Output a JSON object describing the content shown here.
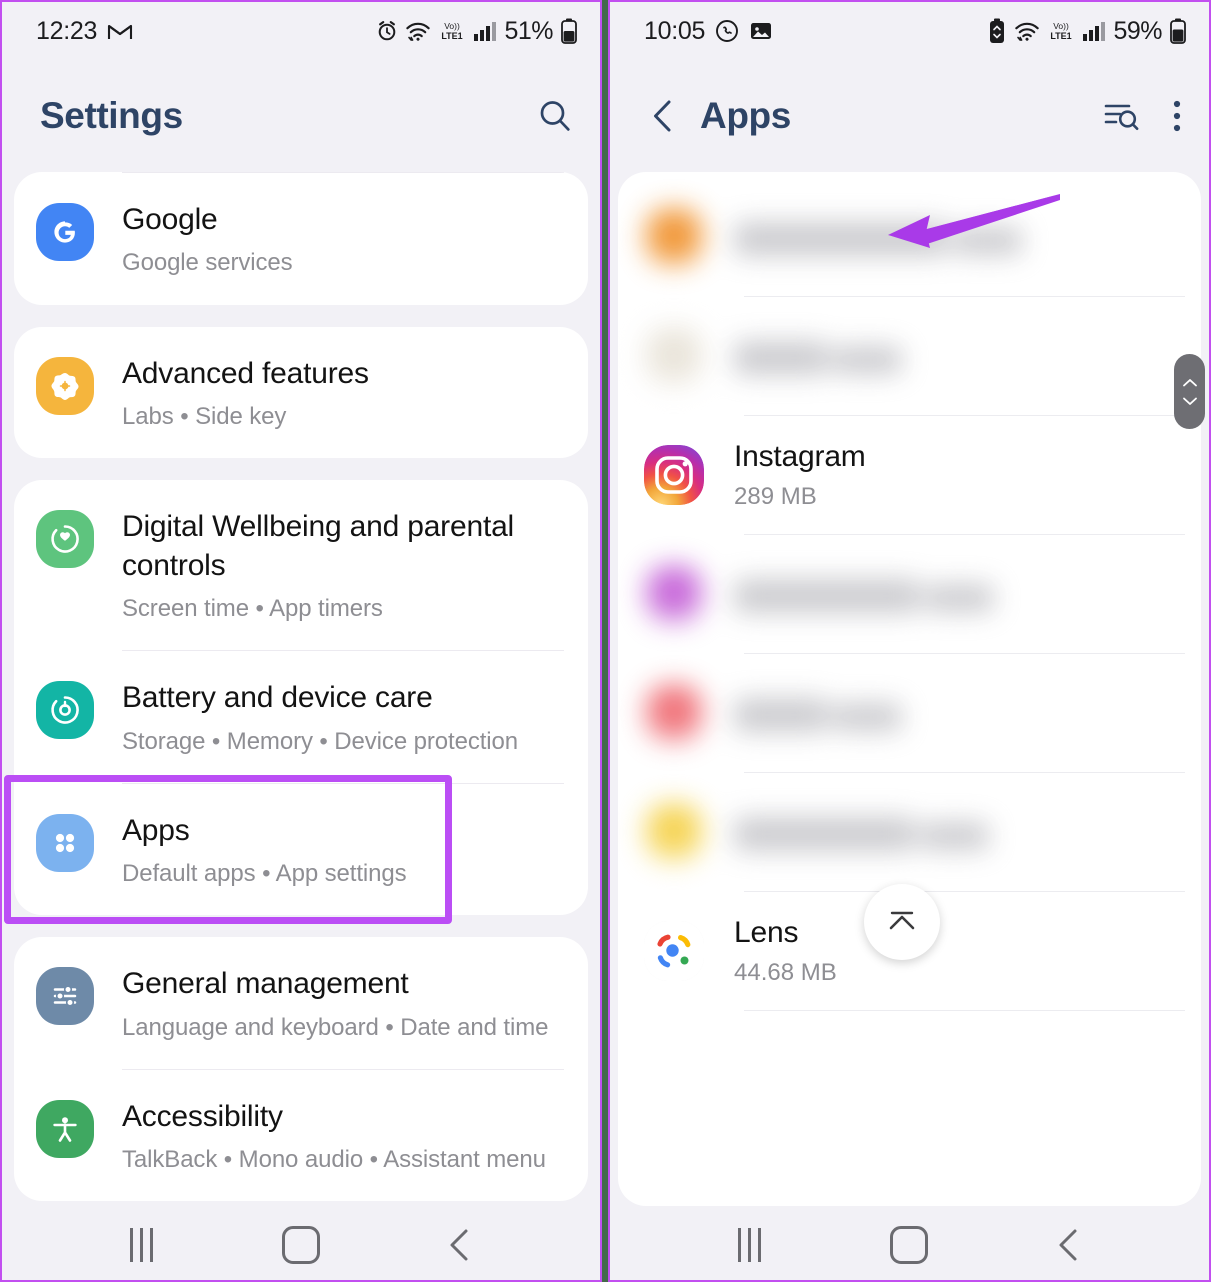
{
  "left_phone": {
    "status_bar": {
      "time": "12:23",
      "icons": [
        "gmail-icon",
        "alarm-icon",
        "wifi-icon",
        "volte-icon",
        "signal-icon"
      ],
      "battery_percent": "51%"
    },
    "header": {
      "title": "Settings",
      "search_icon": "search-icon"
    },
    "groups": [
      {
        "has_top_divider": true,
        "items": [
          {
            "title": "Google",
            "subtitle": "Google services",
            "icon": "google-icon",
            "icon_color": "#4285f4"
          }
        ]
      },
      {
        "has_top_divider": false,
        "items": [
          {
            "title": "Advanced features",
            "subtitle": "Labs • Side key",
            "icon": "advanced-features-icon",
            "icon_color": "#f5b53d"
          }
        ]
      },
      {
        "has_top_divider": false,
        "items": [
          {
            "title": "Digital Wellbeing and parental controls",
            "subtitle": "Screen time • App timers",
            "icon": "digital-wellbeing-icon",
            "icon_color": "#5ec47e"
          },
          {
            "title": "Battery and device care",
            "subtitle": "Storage • Memory • Device protection",
            "icon": "battery-device-care-icon",
            "icon_color": "#13b5a5"
          },
          {
            "title": "Apps",
            "subtitle": "Default apps • App settings",
            "icon": "apps-grid-icon",
            "icon_color": "#7cb2ef",
            "highlighted": true
          }
        ]
      },
      {
        "has_top_divider": false,
        "items": [
          {
            "title": "General management",
            "subtitle": "Language and keyboard • Date and time",
            "icon": "sliders-icon",
            "icon_color": "#6e8aa8"
          },
          {
            "title": "Accessibility",
            "subtitle": "TalkBack • Mono audio • Assistant menu",
            "icon": "accessibility-icon",
            "icon_color": "#3fa861"
          }
        ]
      }
    ]
  },
  "right_phone": {
    "status_bar": {
      "time": "10:05",
      "icons": [
        "whatsapp-icon",
        "photo-icon",
        "battery-saver-icon",
        "wifi-icon",
        "volte-icon",
        "signal-icon"
      ],
      "battery_percent": "59%"
    },
    "header": {
      "title": "Apps",
      "back_icon": "back-chevron-icon",
      "sort_search_icon": "sort-search-icon",
      "more_icon": "more-vertical-icon"
    },
    "apps": [
      {
        "name": "",
        "size": "",
        "blurred": true,
        "icon_color": "#f0922e"
      },
      {
        "name": "",
        "size": "",
        "blurred": true,
        "icon_color": "#e8e3d8"
      },
      {
        "name": "Instagram",
        "size": "289 MB",
        "blurred": false,
        "icon": "instagram-icon"
      },
      {
        "name": "",
        "size": "",
        "blurred": true,
        "icon_color": "#c560d8"
      },
      {
        "name": "",
        "size": "",
        "blurred": true,
        "icon_color": "#ef6a72"
      },
      {
        "name": "",
        "size": "",
        "blurred": true,
        "icon_color": "#f5d14a"
      },
      {
        "name": "Lens",
        "size": "44.68 MB",
        "blurred": false,
        "icon": "google-lens-icon"
      }
    ],
    "scroll_thumb": {
      "up_icon": "chevron-up-icon",
      "down_icon": "chevron-down-icon"
    },
    "fab": {
      "icon": "scroll-to-top-icon"
    }
  },
  "nav_bar": {
    "recents_label": "recents-icon",
    "home_label": "home-icon",
    "back_label": "back-icon"
  },
  "annotations": {
    "highlight_color": "#bb4ef5",
    "arrow_color": "#a93ae8",
    "divider_color": "#44694a",
    "panel_border_color": "#c24ff0"
  }
}
